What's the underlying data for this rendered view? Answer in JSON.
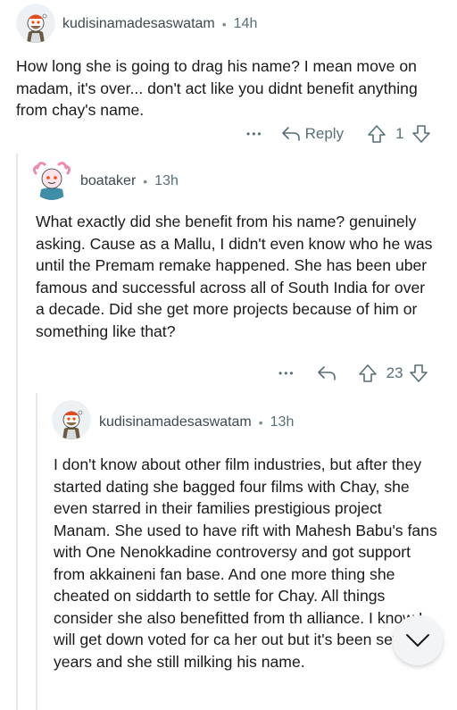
{
  "comments": [
    {
      "username": "kudisinamadesaswatam",
      "separator": "•",
      "time": "14h",
      "body": "How long she is going to drag his name? I mean move on madam, it's over... don't act like you didnt benefit anything from chay's name.",
      "more": "•••",
      "reply_label": "Reply",
      "score": "1"
    },
    {
      "username": "boataker",
      "separator": "•",
      "time": "13h",
      "body": "What exactly did she benefit from his name? genuinely asking. Cause as a Mallu, I didn't even know who he was until the Premam remake happened. She has been uber famous and successful across all of South India for over a decade. Did she get more projects because of him or something like that?",
      "more": "•••",
      "score": "23"
    },
    {
      "username": "kudisinamadesaswatam",
      "separator": "•",
      "time": "13h",
      "body": "I don't know about other film industries, but after they started dating she bagged four films with Chay, she even starred in their families prestigious project Manam. She used to have rift with Mahesh Babu's fans with One Nenokkadine controversy and got support from akkaineni fan base. And one more thing she cheated on siddarth to settle for Chay. All things consider she also benefitted from th alliance. I know I will get down voted for ca her out but it's been several years and she still milking his name."
    }
  ],
  "colors": {
    "text": "#1a1a1b",
    "meta": "#576f76",
    "thread": "#e4e8ea"
  }
}
